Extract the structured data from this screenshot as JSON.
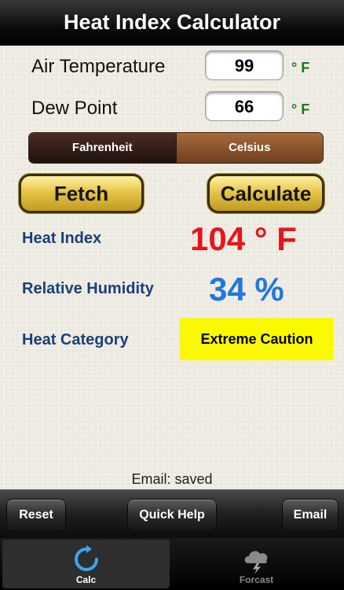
{
  "header": {
    "title": "Heat Index Calculator"
  },
  "inputs": {
    "air_temperature": {
      "label": "Air Temperature",
      "value": "99",
      "unit": "° F"
    },
    "dew_point": {
      "label": "Dew Point",
      "value": "66",
      "unit": "° F"
    }
  },
  "unit_toggle": {
    "fahrenheit": "Fahrenheit",
    "celsius": "Celsius",
    "selected": "Celsius"
  },
  "actions": {
    "fetch": "Fetch",
    "calculate": "Calculate"
  },
  "results": {
    "heat_index": {
      "label": "Heat Index",
      "value": "104 ° F",
      "color": "#e8141c"
    },
    "relative_humidity": {
      "label": "Relative Humidity",
      "value": "34 %",
      "color": "#2277dd"
    },
    "heat_category": {
      "label": "Heat Category",
      "value": "Extreme Caution",
      "color": "#fbf900"
    }
  },
  "status": "Email: saved",
  "toolbar": {
    "reset": "Reset",
    "quick_help": "Quick Help",
    "email": "Email"
  },
  "tabs": [
    {
      "label": "Calc",
      "icon": "refresh-icon",
      "active": true
    },
    {
      "label": "Forcast",
      "icon": "storm-cloud-icon",
      "active": false
    }
  ]
}
